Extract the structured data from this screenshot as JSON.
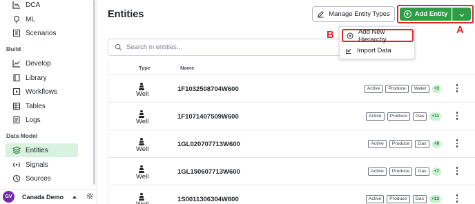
{
  "sidebar": {
    "items_top": [
      {
        "label": "DCA",
        "icon": "chart-line-icon"
      },
      {
        "label": "ML",
        "icon": "lightbulb-icon"
      },
      {
        "label": "Scenarios",
        "icon": "scenarios-icon"
      }
    ],
    "section_build": "Build",
    "items_build": [
      {
        "label": "Develop",
        "icon": "chart-develop-icon"
      },
      {
        "label": "Library",
        "icon": "book-icon"
      },
      {
        "label": "Workflows",
        "icon": "workflow-icon"
      },
      {
        "label": "Tables",
        "icon": "table-icon"
      },
      {
        "label": "Logs",
        "icon": "log-icon"
      }
    ],
    "section_data_model": "Data Model",
    "items_data_model": [
      {
        "label": "Entities",
        "icon": "layers-icon",
        "active": true
      },
      {
        "label": "Signals",
        "icon": "signal-icon"
      },
      {
        "label": "Sources",
        "icon": "source-icon"
      }
    ],
    "footer": {
      "avatar_initials": "GV",
      "org_name": "Canada Demo"
    }
  },
  "header": {
    "title": "Entities",
    "manage_button": "Manage Entity Types",
    "add_button": "Add Entity"
  },
  "annotations": {
    "a": "A",
    "b": "B"
  },
  "dropdown_menu": {
    "items": [
      {
        "label": "Add New Hierarchy",
        "icon": "plus-circle-icon"
      },
      {
        "label": "Import Data",
        "icon": "import-icon"
      }
    ]
  },
  "search": {
    "placeholder": "Search in entities..."
  },
  "table": {
    "columns": [
      "Type",
      "Name"
    ],
    "rows": [
      {
        "type": "Well",
        "name": "1F1032508704W600",
        "tags": [
          "Active",
          "Produce",
          "Water"
        ],
        "more": "+3"
      },
      {
        "type": "Well",
        "name": "1F1071407509W600",
        "tags": [
          "Active",
          "Produce",
          "Gas"
        ],
        "more": "+11"
      },
      {
        "type": "Well",
        "name": "1GL020707713W600",
        "tags": [
          "Active",
          "Produce",
          "Gas"
        ],
        "more": "+9"
      },
      {
        "type": "Well",
        "name": "1GL150607713W600",
        "tags": [
          "Active",
          "Produce",
          "Gas"
        ],
        "more": "+7"
      },
      {
        "type": "Well",
        "name": "1S0011306304W600",
        "tags": [
          "Active",
          "Produce",
          "Gas"
        ],
        "more": "+13"
      }
    ]
  },
  "colors": {
    "accent_green": "#2e9d45",
    "annotation_red": "#e0242b",
    "active_bg": "#d7f2de"
  }
}
